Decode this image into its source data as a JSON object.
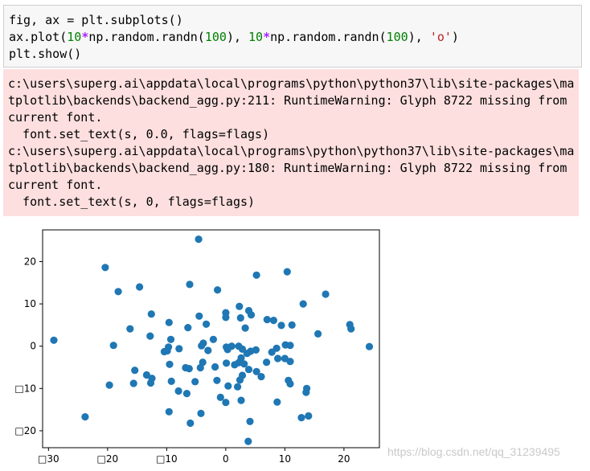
{
  "code_cell": {
    "lines": [
      [
        {
          "t": "fig, ax = plt.subplots()",
          "c": ""
        }
      ],
      [
        {
          "t": "ax.plot(",
          "c": ""
        },
        {
          "t": "10",
          "c": "num"
        },
        {
          "t": "*",
          "c": "op"
        },
        {
          "t": "np.random.randn(",
          "c": ""
        },
        {
          "t": "100",
          "c": "num"
        },
        {
          "t": "), ",
          "c": ""
        },
        {
          "t": "10",
          "c": "num"
        },
        {
          "t": "*",
          "c": "op"
        },
        {
          "t": "np.random.randn(",
          "c": ""
        },
        {
          "t": "100",
          "c": "num"
        },
        {
          "t": "), ",
          "c": ""
        },
        {
          "t": "'o'",
          "c": "str"
        },
        {
          "t": ")",
          "c": ""
        }
      ],
      [
        {
          "t": "plt.show()",
          "c": ""
        }
      ]
    ]
  },
  "stderr": {
    "lines": [
      "c:\\users\\superg.ai\\appdata\\local\\programs\\python\\python37\\lib\\site-packages\\ma",
      "tplotlib\\backends\\backend_agg.py:211: RuntimeWarning: Glyph 8722 missing from",
      "current font.",
      "  font.set_text(s, 0.0, flags=flags)",
      "c:\\users\\superg.ai\\appdata\\local\\programs\\python\\python37\\lib\\site-packages\\ma",
      "tplotlib\\backends\\backend_agg.py:180: RuntimeWarning: Glyph 8722 missing from",
      "current font.",
      "  font.set_text(s, 0, flags=flags)"
    ]
  },
  "chart_data": {
    "type": "scatter",
    "marker_color": "#1f77b4",
    "xlim": [
      -31,
      26
    ],
    "ylim": [
      -24,
      27.5
    ],
    "xticks": [
      -30,
      -20,
      -10,
      0,
      10,
      20
    ],
    "xtick_labels": [
      "□30",
      "□20",
      "□10",
      "0",
      "10",
      "20"
    ],
    "yticks": [
      -20,
      -10,
      0,
      10,
      20
    ],
    "ytick_labels": [
      "□20",
      "□10",
      "0",
      "10",
      "20"
    ],
    "grid": false,
    "points": [
      [
        -4.6,
        25.3
      ],
      [
        -20.4,
        18.6
      ],
      [
        10.4,
        17.6
      ],
      [
        5.2,
        16.8
      ],
      [
        -6.1,
        14.6
      ],
      [
        -14.6,
        14
      ],
      [
        -1.4,
        13.3
      ],
      [
        -18.2,
        12.9
      ],
      [
        16.9,
        12.3
      ],
      [
        13.1,
        10
      ],
      [
        2.3,
        9.4
      ],
      [
        3.9,
        8.4
      ],
      [
        -12.6,
        7.6
      ],
      [
        0,
        7.9
      ],
      [
        4.3,
        7.4
      ],
      [
        -4.5,
        7.1
      ],
      [
        0,
        6.8
      ],
      [
        2.5,
        6.7
      ],
      [
        7,
        6.3
      ],
      [
        8.1,
        6.1
      ],
      [
        -9.6,
        5.6
      ],
      [
        -3.3,
        5.2
      ],
      [
        9.4,
        4.9
      ],
      [
        11.2,
        5
      ],
      [
        -6.4,
        4.4
      ],
      [
        3.3,
        4.3
      ],
      [
        -16.2,
        4.1
      ],
      [
        21,
        5.1
      ],
      [
        21.2,
        4.1
      ],
      [
        15.6,
        2.9
      ],
      [
        -12.8,
        2.4
      ],
      [
        -9.3,
        1.6
      ],
      [
        -2.1,
        1.6
      ],
      [
        -3.8,
        0.7
      ],
      [
        -4.1,
        0.1
      ],
      [
        -29.1,
        1.4
      ],
      [
        -19,
        0.2
      ],
      [
        -9.7,
        -0.2
      ],
      [
        -9.9,
        -1.1
      ],
      [
        -10.4,
        -1.3
      ],
      [
        -7.9,
        -0.6
      ],
      [
        -3,
        -1
      ],
      [
        0.1,
        -0.2
      ],
      [
        0.3,
        -0.8
      ],
      [
        1,
        0
      ],
      [
        2.2,
        0
      ],
      [
        2.8,
        -0.7
      ],
      [
        4.2,
        -1.2
      ],
      [
        5.1,
        -0.9
      ],
      [
        7.8,
        -1.4
      ],
      [
        8.6,
        -0.5
      ],
      [
        10.1,
        0.3
      ],
      [
        10.9,
        0.2
      ],
      [
        24.3,
        -0.1
      ],
      [
        3.6,
        -1.7
      ],
      [
        2.6,
        -2.8
      ],
      [
        8.8,
        -2.9
      ],
      [
        10,
        -2.9
      ],
      [
        10.9,
        -3.6
      ],
      [
        6.9,
        -3.8
      ],
      [
        -3.9,
        -3.8
      ],
      [
        -9.5,
        -4.3
      ],
      [
        0.1,
        -4
      ],
      [
        1.5,
        -4.4
      ],
      [
        2.2,
        -3.9
      ],
      [
        3.1,
        -4.2
      ],
      [
        -6.8,
        -5.1
      ],
      [
        -4.3,
        -5.1
      ],
      [
        -6.2,
        -5.3
      ],
      [
        -1.8,
        -4.9
      ],
      [
        -15.4,
        -5.7
      ],
      [
        3.9,
        -5.5
      ],
      [
        5.2,
        -6
      ],
      [
        2.8,
        -6.9
      ],
      [
        6,
        -7.2
      ],
      [
        -13.4,
        -6.8
      ],
      [
        -12.5,
        -7.6
      ],
      [
        -12.7,
        -8.7
      ],
      [
        -15.6,
        -8.8
      ],
      [
        -9.2,
        -8.3
      ],
      [
        -5.2,
        -8.4
      ],
      [
        -1.5,
        -8.1
      ],
      [
        2.4,
        -8
      ],
      [
        10.6,
        -8.1
      ],
      [
        10.9,
        -8.9
      ],
      [
        -19.7,
        -9.2
      ],
      [
        0.4,
        -9.4
      ],
      [
        2,
        -9.6
      ],
      [
        -8,
        -10.6
      ],
      [
        -6.6,
        -11.2
      ],
      [
        13.7,
        -10
      ],
      [
        13.6,
        -10.9
      ],
      [
        8.7,
        -13.2
      ],
      [
        2.6,
        -12.8
      ],
      [
        -0.9,
        -12.1
      ],
      [
        0,
        -13.3
      ],
      [
        -9.6,
        -15.5
      ],
      [
        -4.2,
        -15.9
      ],
      [
        12.8,
        -16.9
      ],
      [
        14,
        -16.5
      ],
      [
        -23.8,
        -16.7
      ],
      [
        -6,
        -18.2
      ],
      [
        4.1,
        -17.8
      ],
      [
        3.8,
        -22.5
      ]
    ]
  },
  "watermark": "https://blog.csdn.net/qq_31239495"
}
